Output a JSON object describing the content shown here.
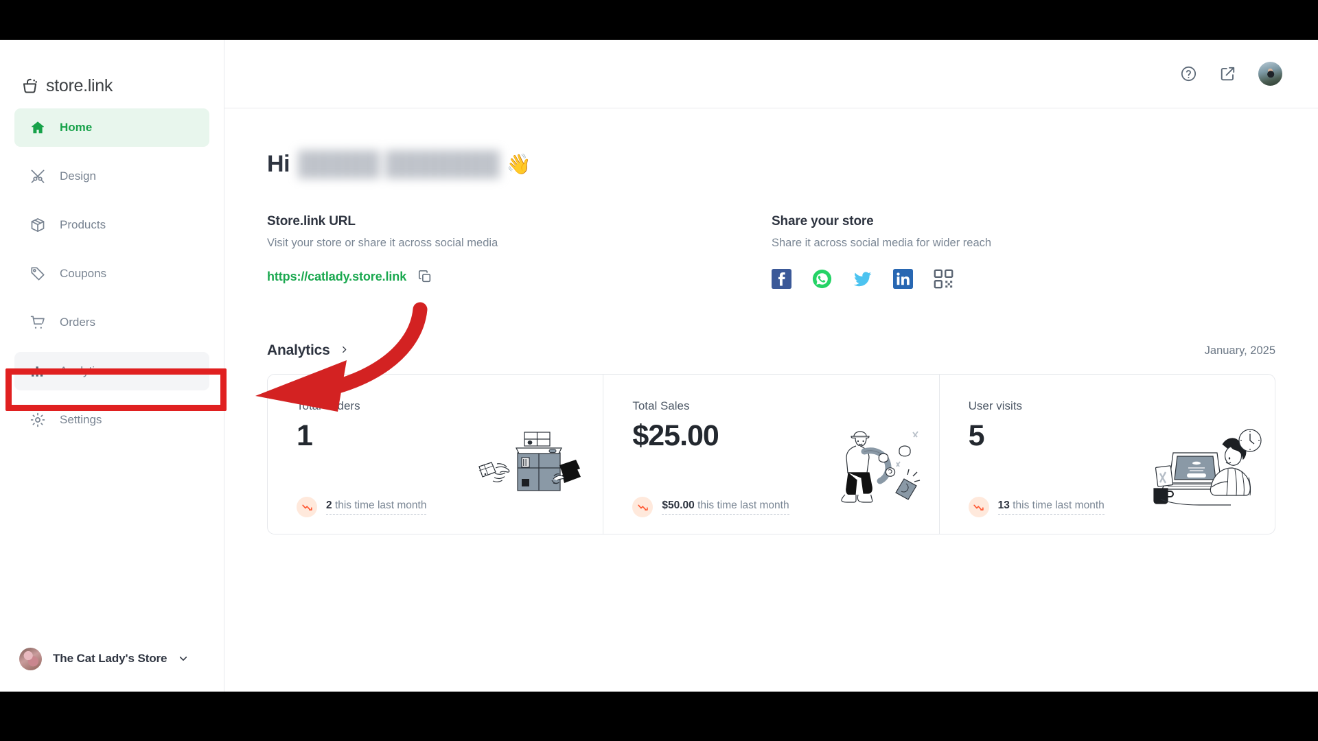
{
  "brand": {
    "name": "store.link",
    "logo_icon": "shopping-basket-icon"
  },
  "sidebar": {
    "items": [
      {
        "label": "Home",
        "icon": "home-icon",
        "active": true
      },
      {
        "label": "Design",
        "icon": "design-tools-icon",
        "active": false
      },
      {
        "label": "Products",
        "icon": "box-icon",
        "active": false
      },
      {
        "label": "Coupons",
        "icon": "tag-icon",
        "active": false
      },
      {
        "label": "Orders",
        "icon": "shopping-cart-icon",
        "active": false
      },
      {
        "label": "Analytics",
        "icon": "bar-chart-icon",
        "active": false
      },
      {
        "label": "Settings",
        "icon": "gear-icon",
        "active": false
      }
    ],
    "store_switcher": {
      "name": "The Cat Lady's Store",
      "avatar_icon": "store-avatar",
      "chevron_icon": "chevron-down-icon"
    }
  },
  "topbar": {
    "help_icon": "help-circle-icon",
    "open_store_icon": "external-link-icon",
    "avatar_icon": "user-avatar"
  },
  "greeting": {
    "prefix": "Hi",
    "name": "█████ ███████",
    "emoji": "👋"
  },
  "url_section": {
    "title": "Store.link URL",
    "subtitle": "Visit your store or share it across social media",
    "url": "https://catlady.store.link",
    "copy_icon": "copy-icon"
  },
  "share_section": {
    "title": "Share your store",
    "subtitle": "Share it across social media for wider reach",
    "socials": [
      {
        "name": "facebook-icon",
        "color": "#3b5998"
      },
      {
        "name": "whatsapp-icon",
        "color": "#25d366"
      },
      {
        "name": "twitter-icon",
        "color": "#1da1f2"
      },
      {
        "name": "linkedin-icon",
        "color": "#2867b2"
      },
      {
        "name": "qr-code-icon",
        "color": "#5a6472"
      }
    ]
  },
  "analytics": {
    "title": "Analytics",
    "chevron_icon": "chevron-right-icon",
    "period": "January, 2025",
    "cards": [
      {
        "title": "Total Orders",
        "value": "1",
        "compare_value": "2",
        "compare_text": "this time last month",
        "trend": "down",
        "trend_icon": "trend-down-icon",
        "illustration": "packages-delivery-illustration"
      },
      {
        "title": "Total Sales",
        "value": "$25.00",
        "compare_value": "$50.00",
        "compare_text": "this time last month",
        "trend": "down",
        "trend_icon": "trend-down-icon",
        "illustration": "magnet-money-illustration"
      },
      {
        "title": "User visits",
        "value": "5",
        "compare_value": "13",
        "compare_text": "this time last month",
        "trend": "down",
        "trend_icon": "trend-down-icon",
        "illustration": "person-laptop-illustration"
      }
    ]
  },
  "annotations": {
    "highlight_target": "Analytics",
    "highlight_color": "#e02020",
    "arrow_color": "#d32222",
    "arrow_icon": "curved-arrow-left-icon"
  },
  "colors": {
    "accent_green": "#17a24a",
    "link_green": "#1aa84f",
    "text_dark": "#2e3440",
    "text_muted": "#7a8694",
    "annotation_red": "#e02020",
    "trend_down": "#ff5630"
  }
}
